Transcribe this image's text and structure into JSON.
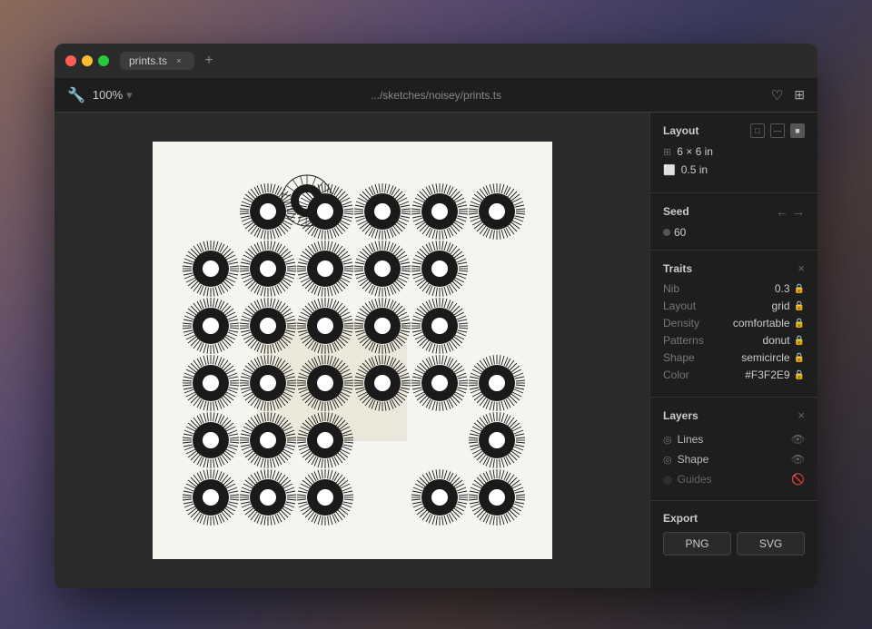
{
  "window": {
    "title": "prints.ts",
    "tab_close": "×",
    "tab_add": "+"
  },
  "toolbar": {
    "zoom": "100%",
    "zoom_arrow": "▾",
    "path": ".../sketches/noisey/prints.ts",
    "heart_icon": "♡",
    "grid_icon": "⊞",
    "tool_icon": "🔧"
  },
  "layout_panel": {
    "title": "Layout",
    "dimensions": "6 × 6 in",
    "margin": "0.5 in",
    "icons": [
      "□",
      "—",
      "■"
    ]
  },
  "seed_panel": {
    "title": "Seed",
    "value": "60",
    "prev_arrow": "←",
    "next_arrow": "→"
  },
  "traits_panel": {
    "title": "Traits",
    "close": "×",
    "items": [
      {
        "label": "Nib",
        "value": "0.3"
      },
      {
        "label": "Layout",
        "value": "grid"
      },
      {
        "label": "Density",
        "value": "comfortable"
      },
      {
        "label": "Patterns",
        "value": "donut"
      },
      {
        "label": "Shape",
        "value": "semicircle"
      },
      {
        "label": "Color",
        "value": "#F3F2E9"
      }
    ]
  },
  "layers_panel": {
    "title": "Layers",
    "close": "×",
    "items": [
      {
        "name": "Lines",
        "visible": true,
        "icon": "◎"
      },
      {
        "name": "Shape",
        "visible": true,
        "icon": "◎"
      },
      {
        "name": "Guides",
        "visible": false,
        "icon": "◎"
      }
    ]
  },
  "export_panel": {
    "title": "Export",
    "buttons": [
      "PNG",
      "SVG"
    ]
  },
  "colors": {
    "accent": "#f5f5f0",
    "panel_bg": "#1e1e1e",
    "border": "#333333"
  }
}
